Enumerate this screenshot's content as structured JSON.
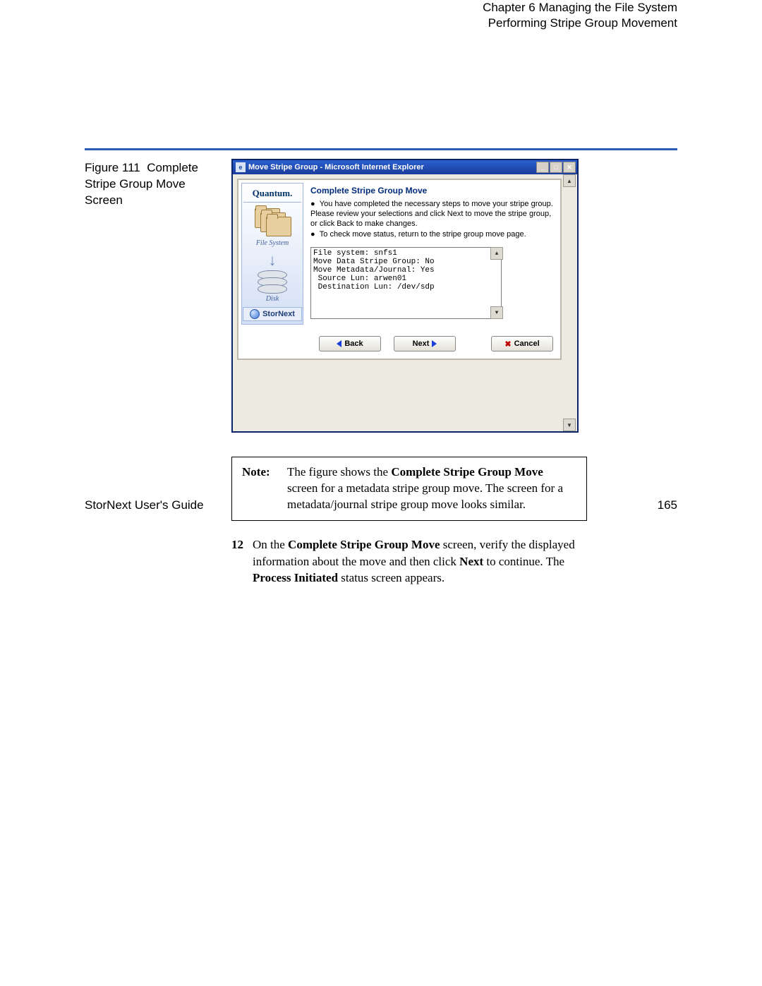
{
  "header": {
    "chapter": "Chapter 6  Managing the File System",
    "section": "Performing Stripe Group Movement"
  },
  "figure_caption": {
    "label": "Figure 111",
    "text": "Complete Stripe Group Move Screen"
  },
  "ie_window": {
    "title": "Move Stripe Group - Microsoft Internet Explorer",
    "sidebar": {
      "brand": "Quantum.",
      "file_system_label": "File System",
      "disk_label": "Disk",
      "product": "StorNext"
    },
    "main": {
      "title": "Complete Stripe Group Move",
      "bullet1": "You have completed the necessary steps to move your stripe group. Please review your selections and click Next to move the stripe group, or click Back to make changes.",
      "bullet2": "To check move status, return to the stripe group move page.",
      "mono_lines": [
        "File system: snfs1",
        "Move Data Stripe Group: No",
        "Move Metadata/Journal: Yes",
        " Source Lun: arwen01",
        " Destination Lun: /dev/sdp"
      ]
    },
    "buttons": {
      "back": "Back",
      "next": "Next",
      "cancel": "Cancel"
    }
  },
  "note": {
    "label": "Note:",
    "text_before": "The figure shows the ",
    "bold": "Complete Stripe Group Move",
    "text_after": " screen for a metadata stripe group move. The screen for a metadata/journal stripe group move looks similar."
  },
  "step": {
    "num": "12",
    "t1": "On the ",
    "b1": "Complete Stripe Group Move",
    "t2": " screen, verify the displayed information about the move and then click ",
    "b2": "Next",
    "t3": " to continue. The ",
    "b3": "Process Initiated",
    "t4": " status screen appears."
  },
  "footer": {
    "left": "StorNext User's Guide",
    "right": "165"
  }
}
